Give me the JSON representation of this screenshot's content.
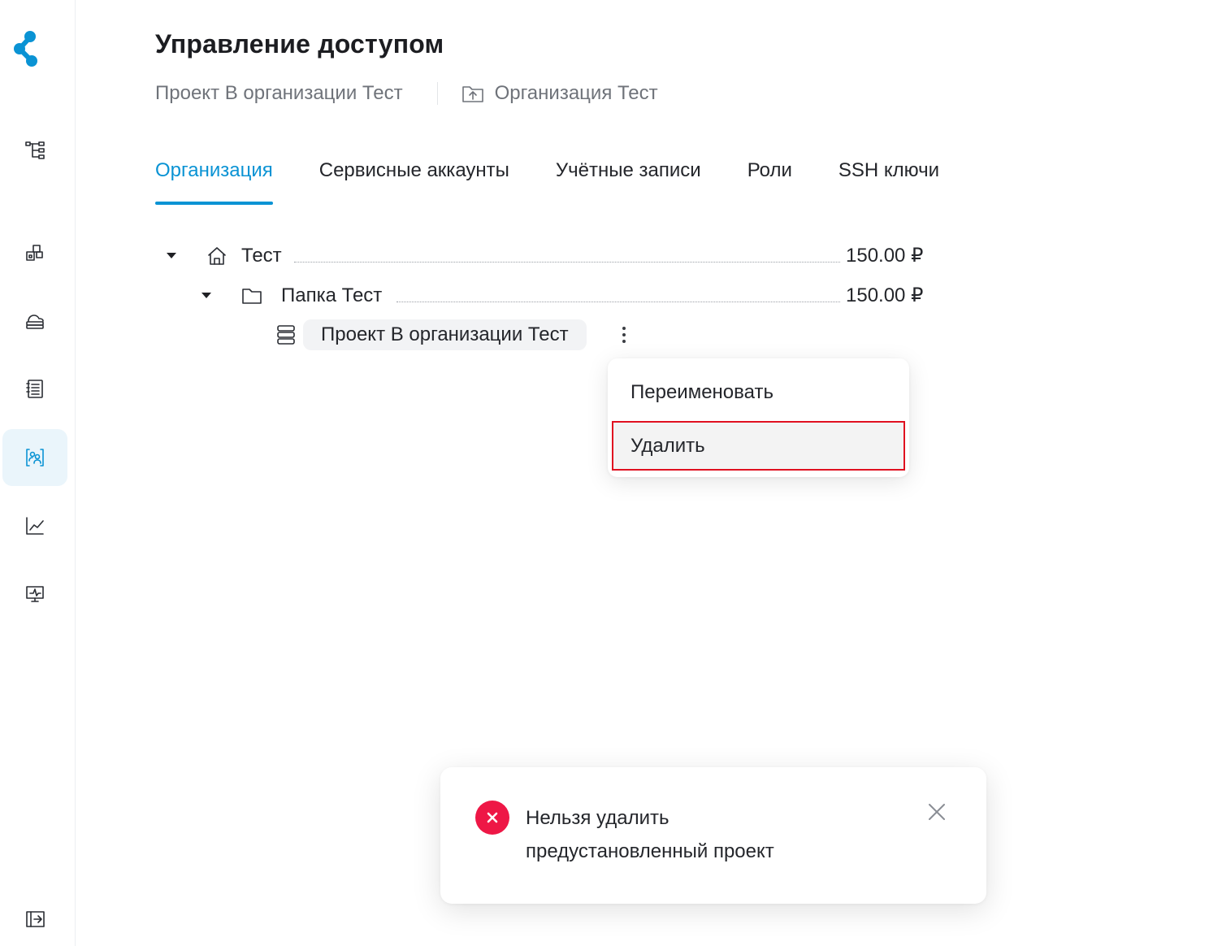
{
  "app": {
    "logo_icon": "ripple-logo-icon",
    "accent_color": "#0a93d4",
    "error_color": "#ee1746"
  },
  "sidebar": {
    "items": [
      {
        "icon": "hierarchy-icon",
        "active": false
      },
      {
        "icon": "cubes-icon",
        "active": false
      },
      {
        "icon": "cloud-storage-icon",
        "active": false
      },
      {
        "icon": "document-list-icon",
        "active": false
      },
      {
        "icon": "access-users-icon",
        "active": true
      },
      {
        "icon": "chart-line-icon",
        "active": false
      },
      {
        "icon": "monitor-pulse-icon",
        "active": false
      }
    ],
    "collapse_icon": "expand-sidebar-icon"
  },
  "header": {
    "title": "Управление доступом",
    "breadcrumb_project": "Проект В организации Тест",
    "breadcrumb_org": "Организация Тест"
  },
  "tabs": [
    {
      "label": "Организация",
      "active": true
    },
    {
      "label": "Сервисные аккаунты",
      "active": false
    },
    {
      "label": "Учётные записи",
      "active": false
    },
    {
      "label": "Роли",
      "active": false
    },
    {
      "label": "SSH ключи",
      "active": false
    }
  ],
  "tree": {
    "org": {
      "name": "Тест",
      "price": "150.00 ₽",
      "icon": "home-icon"
    },
    "folder": {
      "name": "Папка Тест",
      "price": "150.00 ₽",
      "icon": "folder-icon"
    },
    "project": {
      "name": "Проект В организации Тест",
      "icon": "server-stack-icon"
    }
  },
  "context_menu": {
    "items": [
      {
        "label": "Переименовать"
      },
      {
        "label": "Удалить",
        "highlighted": true
      }
    ]
  },
  "toast": {
    "line1": "Нельзя удалить",
    "line2": "предустановленный проект",
    "icon": "error-x-icon",
    "close_icon": "close-icon"
  }
}
